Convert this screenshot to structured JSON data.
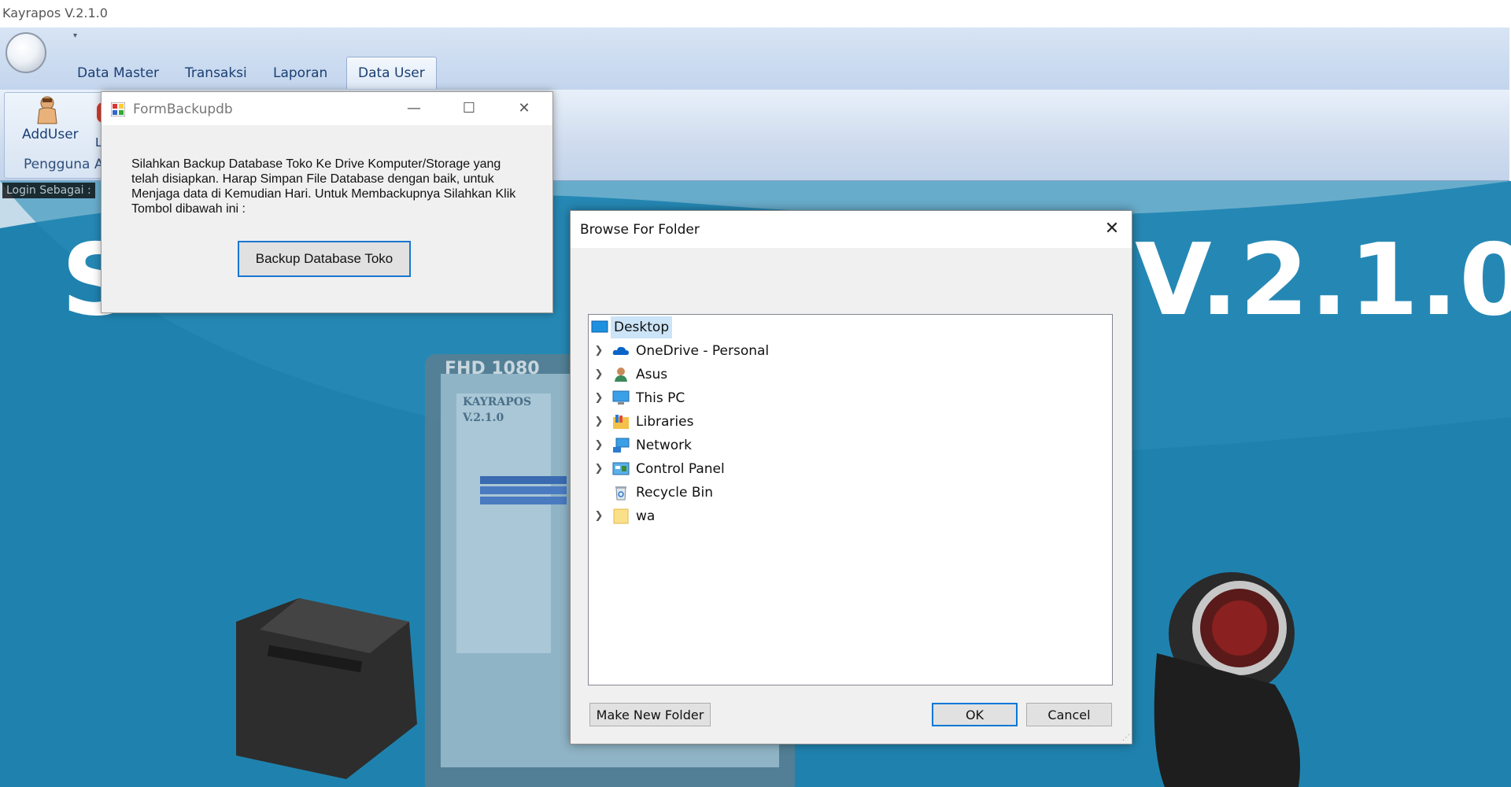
{
  "app": {
    "title": "Kayrapos V.2.1.0"
  },
  "ribbon": {
    "tabs": [
      {
        "label": "Data Master"
      },
      {
        "label": "Transaksi"
      },
      {
        "label": "Laporan"
      },
      {
        "label": "Data User",
        "active": true
      }
    ],
    "group": {
      "buttons": [
        {
          "label": "AddUser"
        },
        {
          "label": "L"
        }
      ],
      "label": "Pengguna A"
    }
  },
  "status": {
    "login_label": "Login Sebagai :"
  },
  "splash": {
    "logo_left": "S",
    "logo_right": "V.2.1.0",
    "accent_color": "#1f82ae"
  },
  "backup_form": {
    "title": "FormBackupdb",
    "message": "Silahkan Backup Database Toko Ke Drive Komputer/Storage yang telah disiapkan. Harap Simpan File Database dengan baik, untuk Menjaga data di Kemudian Hari. Untuk Membackupnya Silahkan Klik Tombol dibawah ini :",
    "button_label": "Backup Database Toko",
    "controls": {
      "minimize": "—",
      "maximize": "☐",
      "close": "✕"
    }
  },
  "browse_dialog": {
    "title": "Browse For Folder",
    "close": "✕",
    "tree": [
      {
        "label": "Desktop",
        "icon": "desktop-icon",
        "selected": true,
        "expandable": false
      },
      {
        "label": "OneDrive - Personal",
        "icon": "cloud-icon",
        "expandable": true
      },
      {
        "label": "Asus",
        "icon": "user-icon",
        "expandable": true
      },
      {
        "label": "This PC",
        "icon": "computer-icon",
        "expandable": true
      },
      {
        "label": "Libraries",
        "icon": "library-icon",
        "expandable": true
      },
      {
        "label": "Network",
        "icon": "network-icon",
        "expandable": true
      },
      {
        "label": "Control Panel",
        "icon": "control-panel-icon",
        "expandable": true
      },
      {
        "label": "Recycle Bin",
        "icon": "recycle-bin-icon",
        "expandable": false
      },
      {
        "label": "wa",
        "icon": "folder-icon",
        "expandable": true
      }
    ],
    "buttons": {
      "make_new_folder": "Make New Folder",
      "ok": "OK",
      "cancel": "Cancel"
    }
  }
}
